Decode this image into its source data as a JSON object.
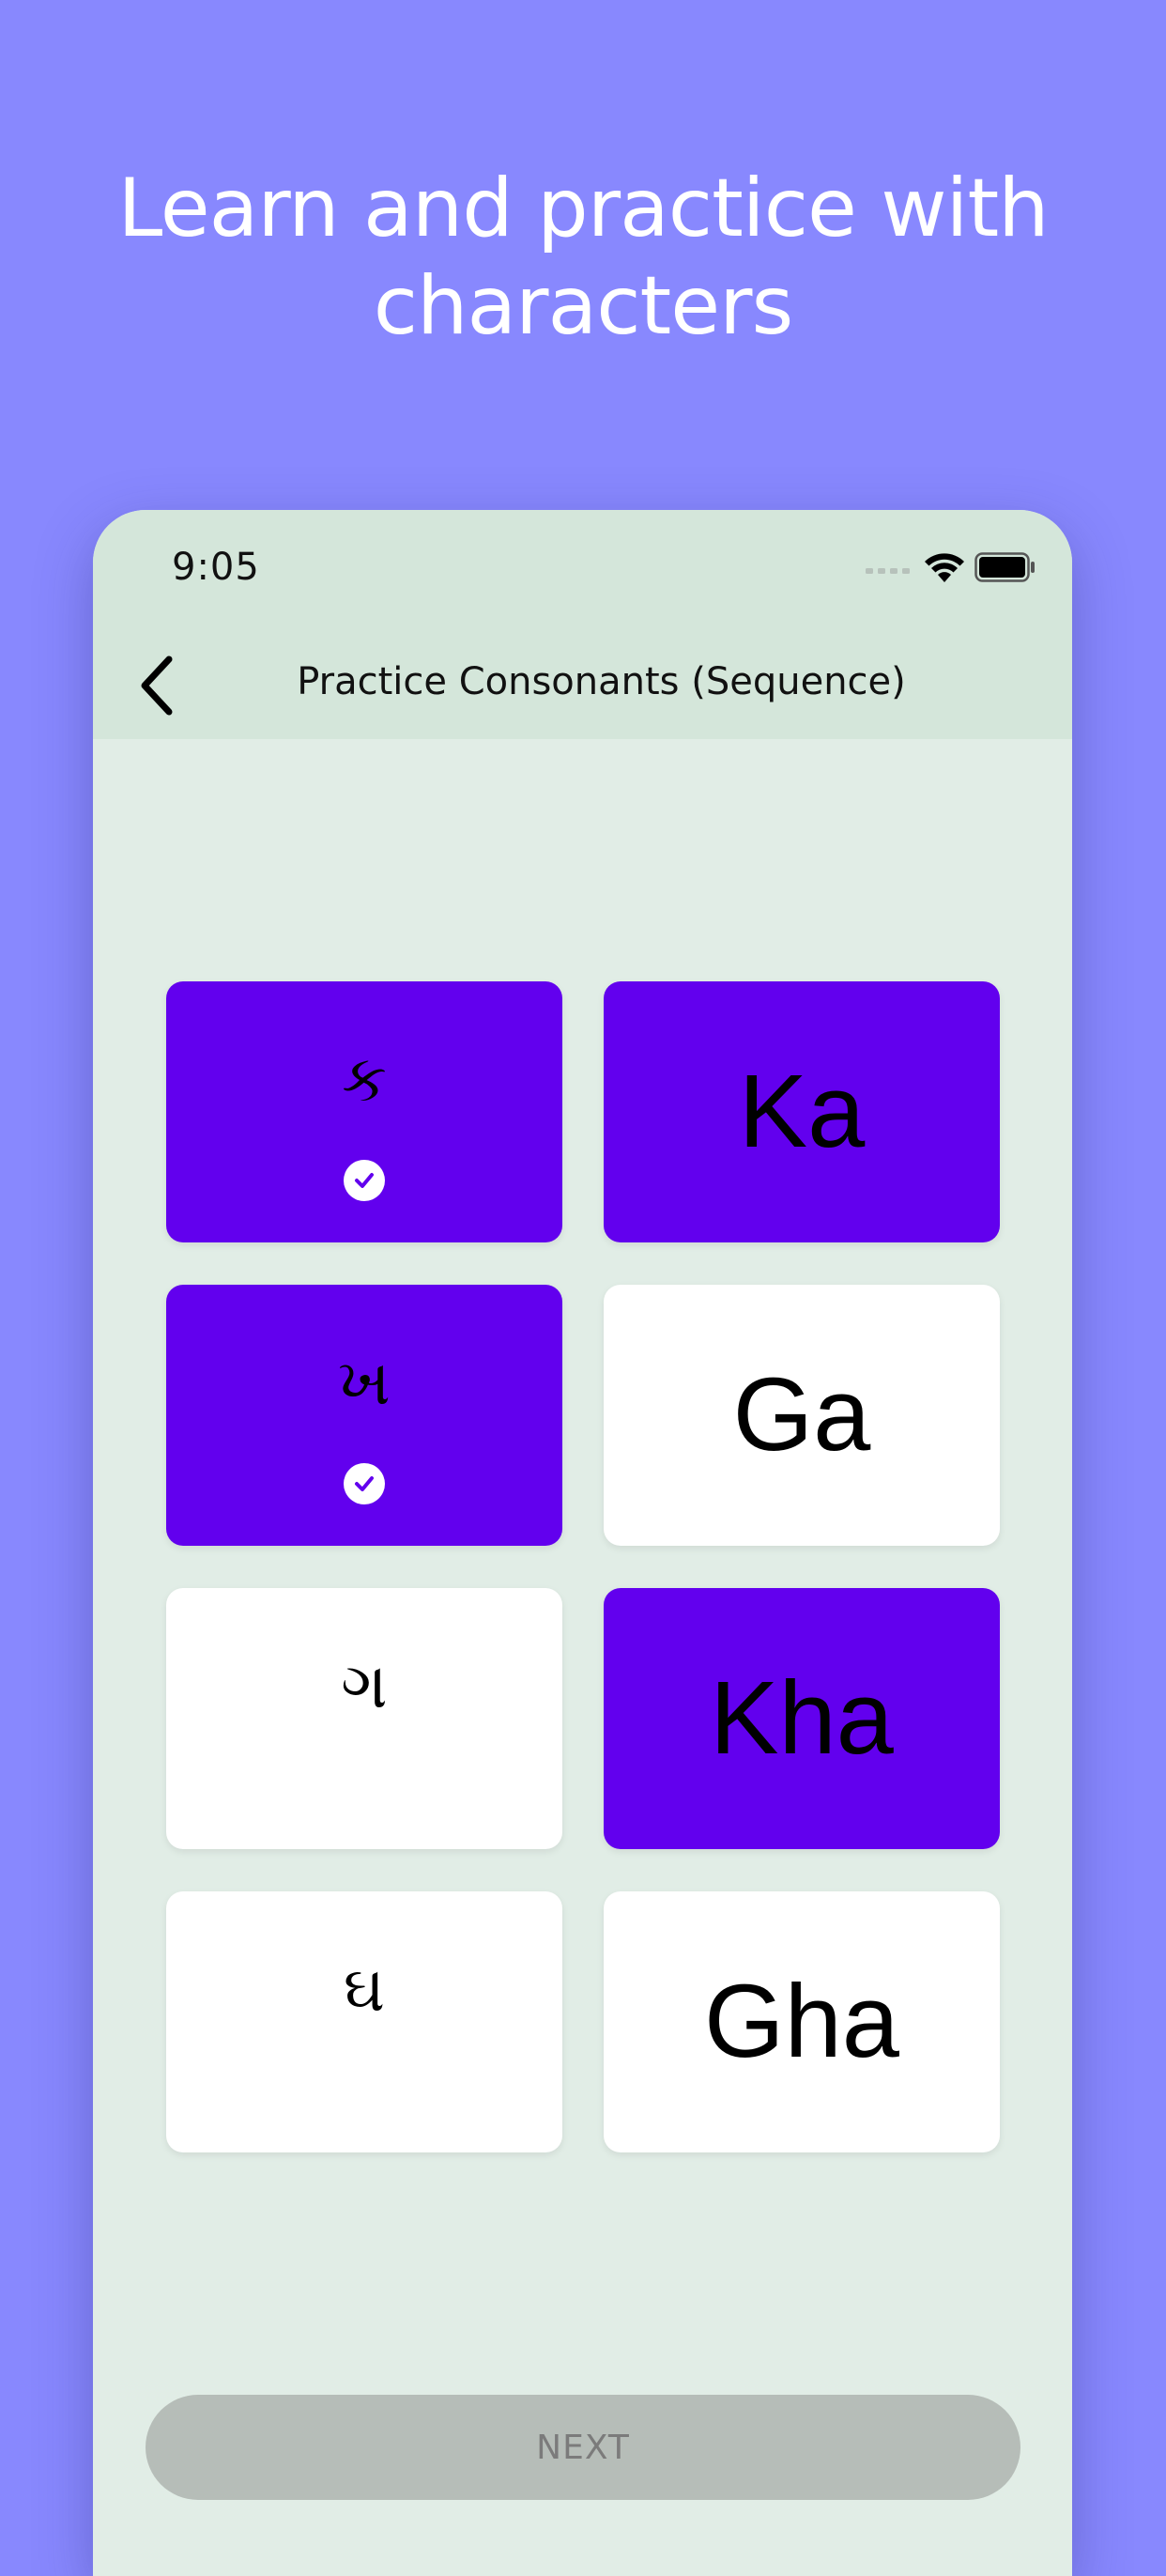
{
  "headline": {
    "line1": "Learn and practice with",
    "line2": "characters"
  },
  "status_bar": {
    "time": "9:05",
    "icons": [
      "cellular-signal-icon",
      "wifi-icon",
      "battery-icon"
    ]
  },
  "nav": {
    "title": "Practice Consonants (Sequence)",
    "back_icon": "chevron-left-icon"
  },
  "cards": [
    {
      "text": "ક",
      "kind": "gujarati",
      "selected": true,
      "checked": true
    },
    {
      "text": "Ka",
      "kind": "roman",
      "selected": true,
      "checked": false
    },
    {
      "text": "ખ",
      "kind": "gujarati",
      "selected": true,
      "checked": true
    },
    {
      "text": "Ga",
      "kind": "roman",
      "selected": false,
      "checked": false
    },
    {
      "text": "ગ",
      "kind": "gujarati",
      "selected": false,
      "checked": false
    },
    {
      "text": "Kha",
      "kind": "roman",
      "selected": true,
      "checked": false
    },
    {
      "text": "ઘ",
      "kind": "gujarati",
      "selected": false,
      "checked": false
    },
    {
      "text": "Gha",
      "kind": "roman",
      "selected": false,
      "checked": false
    }
  ],
  "next_button": {
    "label": "NEXT",
    "enabled": false
  },
  "colors": {
    "page_background": "#8888fe",
    "screen_background": "#e1ede6",
    "bar_background": "#d4e6da",
    "selected_card": "#6200ee",
    "card": "#ffffff",
    "disabled_button": "#b6bdb8"
  }
}
